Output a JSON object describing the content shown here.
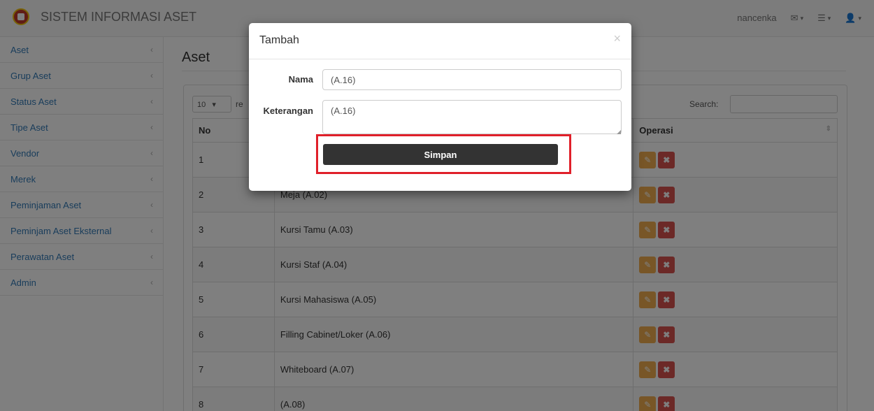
{
  "app": {
    "title": "SISTEM INFORMASI ASET"
  },
  "topbar": {
    "username": "nancenka",
    "mail_icon": "envelope-icon",
    "tasks_icon": "tasks-icon",
    "user_icon": "user-icon",
    "caret": "▾"
  },
  "sidebar": {
    "items": [
      {
        "label": "Aset"
      },
      {
        "label": "Grup Aset"
      },
      {
        "label": "Status Aset"
      },
      {
        "label": "Tipe Aset"
      },
      {
        "label": "Vendor"
      },
      {
        "label": "Merek"
      },
      {
        "label": "Peminjaman Aset"
      },
      {
        "label": "Peminjam Aset Eksternal"
      },
      {
        "label": "Perawatan Aset"
      },
      {
        "label": "Admin"
      }
    ],
    "caret": "‹"
  },
  "main": {
    "page_title": "Aset",
    "length_value": "10",
    "length_text": "re",
    "search_label": "Search:",
    "table": {
      "headers": [
        "No",
        "",
        "Operasi"
      ],
      "rows": [
        {
          "no": "1",
          "name": ""
        },
        {
          "no": "2",
          "name": "Meja (A.02)"
        },
        {
          "no": "3",
          "name": "Kursi Tamu (A.03)"
        },
        {
          "no": "4",
          "name": "Kursi Staf (A.04)"
        },
        {
          "no": "5",
          "name": "Kursi Mahasiswa (A.05)"
        },
        {
          "no": "6",
          "name": "Filling Cabinet/Loker (A.06)"
        },
        {
          "no": "7",
          "name": "Whiteboard (A.07)"
        },
        {
          "no": "8",
          "name": "(A.08)"
        }
      ]
    },
    "edit_glyph": "✎",
    "delete_glyph": "✖"
  },
  "modal": {
    "title": "Tambah",
    "close": "×",
    "nama_label": "Nama",
    "nama_value": "(A.16)",
    "keterangan_label": "Keterangan",
    "keterangan_value": "(A.16)",
    "submit_label": "Simpan"
  },
  "colors": {
    "highlight": "#e0202a",
    "edit": "#f0ad4e",
    "delete": "#d9534f",
    "submit": "#333333"
  }
}
